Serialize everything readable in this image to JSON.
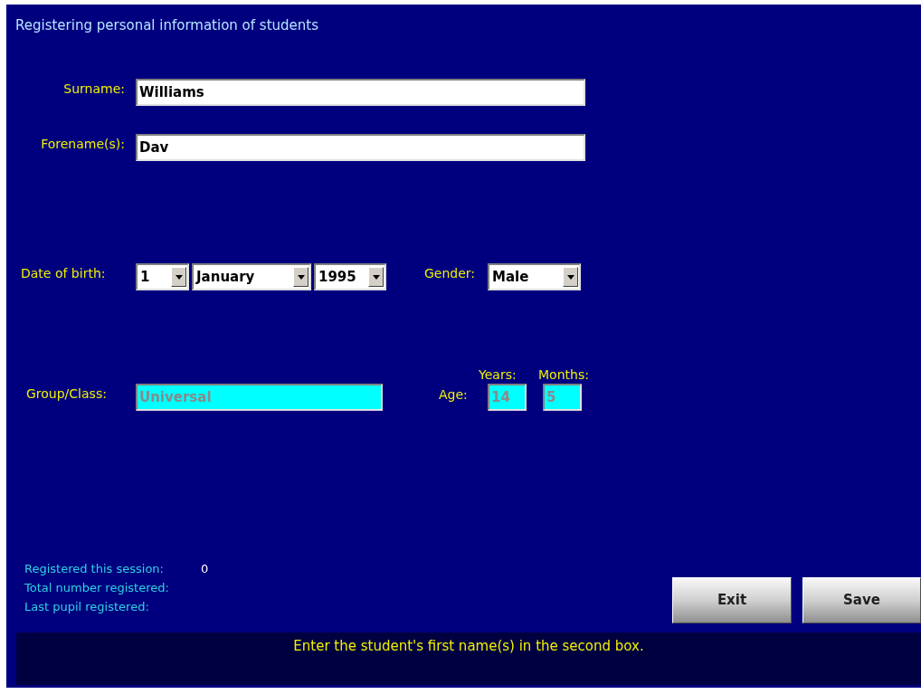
{
  "title": "Registering personal information of students",
  "name_fields": [
    {
      "label": "Surname:",
      "value": "Williams"
    },
    {
      "label": "Forename(s):",
      "value": "Dav"
    }
  ],
  "date_of_birth": {
    "label": "Date of birth:",
    "day": "1",
    "month": "January",
    "year": "1995"
  },
  "gender": {
    "label": "Gender:",
    "value": "Male"
  },
  "group_class": {
    "label": "Group/Class:",
    "value": "Universal",
    "disabled": true
  },
  "age": {
    "label": "Age:",
    "years_label": "Years:",
    "years": "14",
    "months_label": "Months:",
    "months": "5",
    "disabled": true
  },
  "stats": [
    {
      "label": "Registered this session:",
      "value": "0"
    },
    {
      "label": "Total number registered:"
    },
    {
      "label": "Last pupil registered:"
    }
  ],
  "buttons": [
    "Exit",
    "Save"
  ],
  "message": "Enter the student's first name(s) in the second box."
}
